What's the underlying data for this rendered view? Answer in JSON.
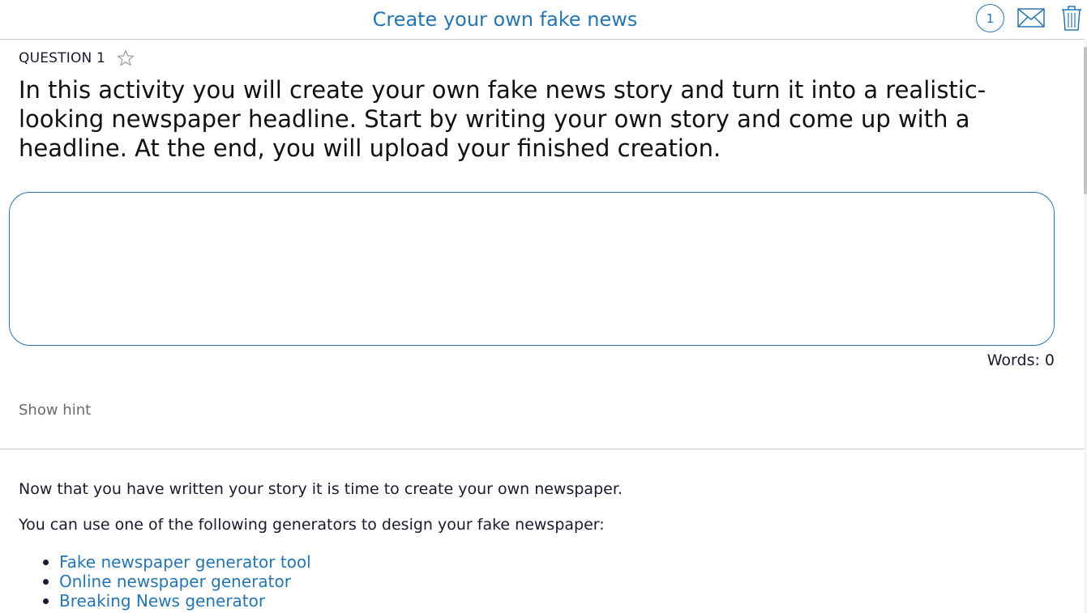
{
  "header": {
    "title": "Create your own fake news",
    "counter": "1",
    "mail_icon": "mail-icon",
    "trash_icon": "trash-icon"
  },
  "question": {
    "label": "QUESTION 1",
    "star_icon": "star-icon",
    "text": "In this activity you will create your own fake news story and turn it into a realistic-looking newspaper headline. Start by writing your own story and come up with a headline. At the end, you will upload your finished creation.",
    "answer_value": "",
    "word_count": "Words: 0",
    "hint_label": "Show hint"
  },
  "info": {
    "paragraph_1": "Now that you have written your story it is time to create your own newspaper.",
    "paragraph_2": "You can use one of the following generators to design your fake newspaper:",
    "links": [
      "Fake newspaper generator tool",
      "Online newspaper generator",
      "Breaking News generator"
    ]
  },
  "colors": {
    "accent": "#2576b0",
    "text": "#1a1a2e",
    "hint": "#6b6b6b",
    "divider": "#c8c8c8"
  }
}
